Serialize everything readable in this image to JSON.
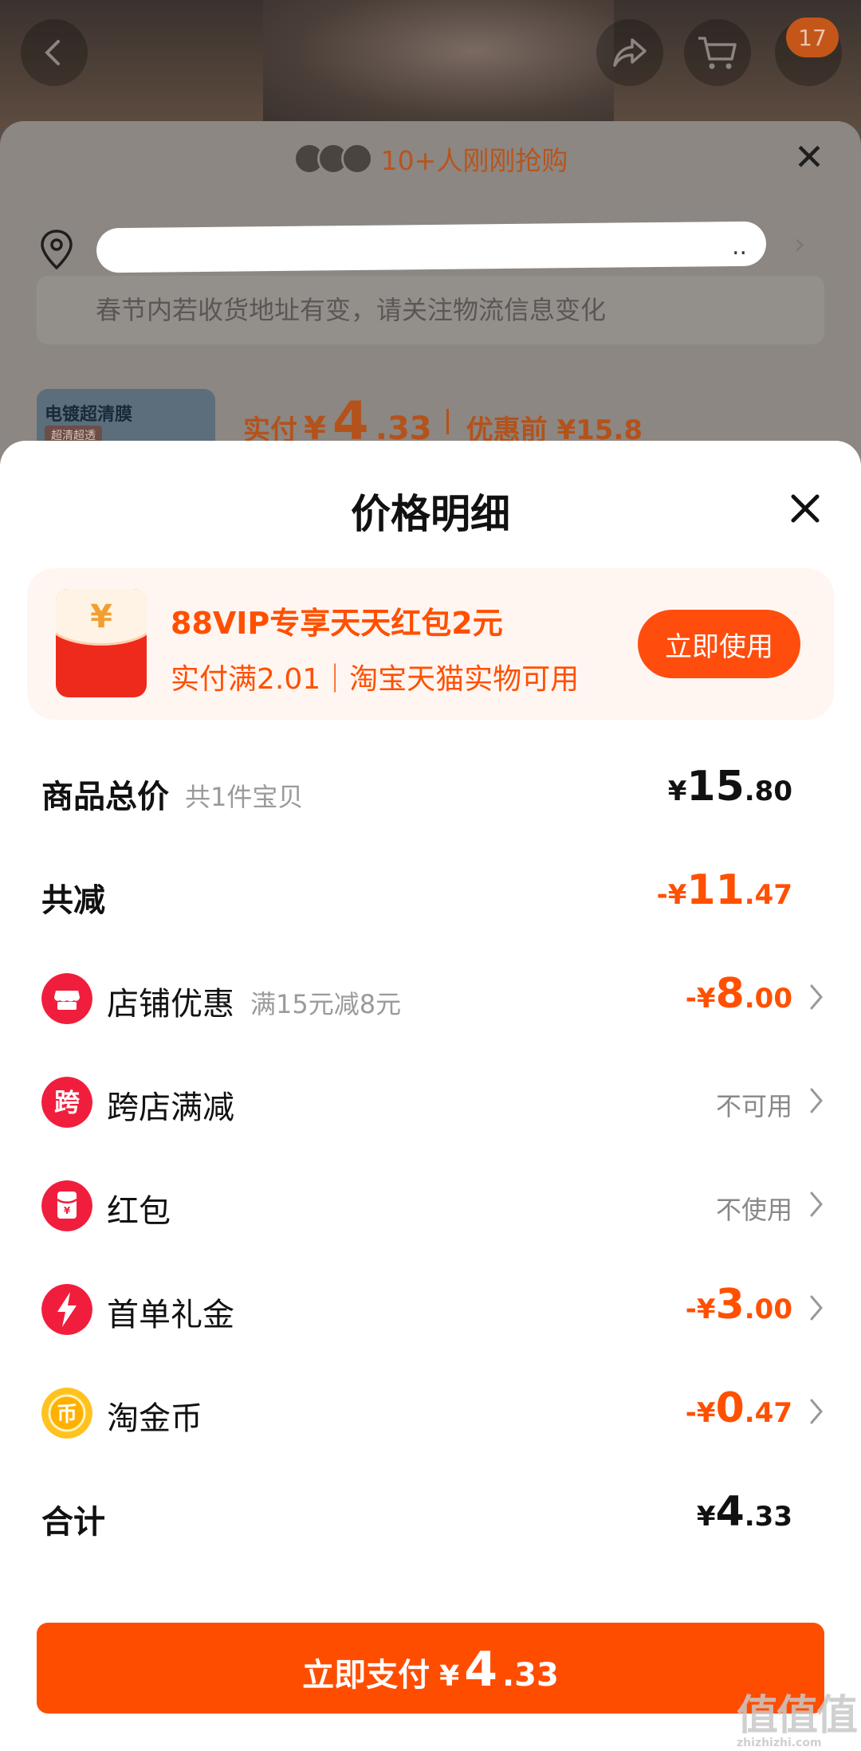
{
  "background_page": {
    "cart_badge": "17",
    "recent_buyers_text": "10+人刚刚抢购",
    "address_notice": "春节内若收货地址有变，请关注物流信息变化",
    "product_thumb_title": "电镀超清膜",
    "product_thumb_tag": "超清超透",
    "price_label": "实付",
    "price_currency": "¥",
    "price_integer": "4",
    "price_decimal": ".33",
    "original_price": "优惠前 ¥15.8"
  },
  "modal": {
    "title": "价格明细",
    "promo": {
      "title": "88VIP专享天天红包2元",
      "subtitle": "实付满2.01｜淘宝天猫实物可用",
      "button_label": "立即使用"
    },
    "rows": {
      "goods_total": {
        "label": "商品总价",
        "hint": "共1件宝贝",
        "currency": "¥",
        "integer": "15",
        "decimal": ".80"
      },
      "total_discount": {
        "label": "共减",
        "currency": "-¥",
        "integer": "11",
        "decimal": ".47"
      },
      "store_discount": {
        "label": "店铺优惠",
        "hint": "满15元减8元",
        "currency": "-¥",
        "integer": "8",
        "decimal": ".00"
      },
      "cross_store": {
        "label": "跨店满减",
        "status": "不可用"
      },
      "red_packet": {
        "label": "红包",
        "status": "不使用"
      },
      "first_order": {
        "label": "首单礼金",
        "currency": "-¥",
        "integer": "3",
        "decimal": ".00"
      },
      "taojinbi": {
        "label": "淘金币",
        "currency": "-¥",
        "integer": "0",
        "decimal": ".47"
      },
      "total": {
        "label": "合计",
        "currency": "¥",
        "integer": "4",
        "decimal": ".33"
      }
    },
    "pay_button": {
      "label": "立即支付",
      "currency": "¥",
      "integer": "4",
      "decimal": ".33"
    }
  },
  "icons": {
    "store_discount": "store-icon",
    "cross_store": "cross-store-icon",
    "red_packet": "red-packet-icon",
    "first_order": "lightning-icon",
    "taojinbi": "coin-icon"
  },
  "watermark": {
    "mark": "值值值",
    "url": "zhizhizhi.com"
  },
  "colors": {
    "accent": "#ff5000",
    "pay_button": "#ff4d00",
    "promo_bg": "#fff6f2"
  }
}
